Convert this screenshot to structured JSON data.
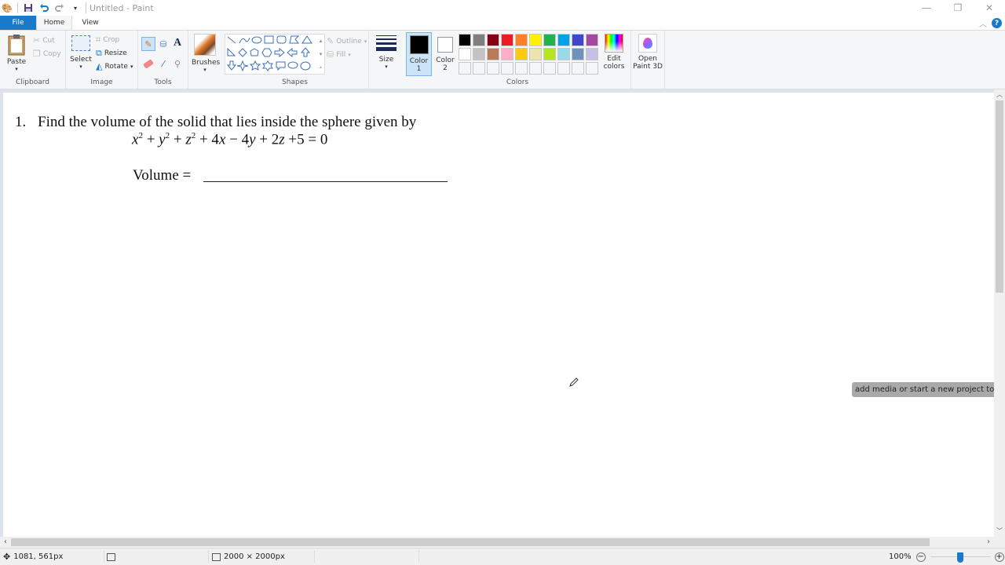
{
  "window": {
    "title": "Untitled - Paint",
    "controls": {
      "minimize": "—",
      "maximize": "❐",
      "close": "✕"
    }
  },
  "quick_access": {
    "icons": [
      "paint-app-icon",
      "save-icon",
      "undo-icon",
      "redo-icon",
      "customize-dropdown-icon"
    ]
  },
  "tabs": [
    {
      "label": "File",
      "active": false
    },
    {
      "label": "Home",
      "active": true
    },
    {
      "label": "View",
      "active": false
    }
  ],
  "ribbon": {
    "clipboard": {
      "label": "Clipboard",
      "paste": "Paste",
      "cut": "Cut",
      "copy": "Copy"
    },
    "image": {
      "label": "Image",
      "select": "Select",
      "crop": "Crop",
      "resize": "Resize",
      "rotate": "Rotate"
    },
    "tools": {
      "label": "Tools",
      "items": [
        "pencil",
        "fill",
        "text",
        "eraser",
        "color-picker",
        "magnifier"
      ]
    },
    "brushes": {
      "label": "Brushes"
    },
    "shapes": {
      "label": "Shapes",
      "outline": "Outline",
      "fill": "Fill"
    },
    "size": {
      "label": "Size"
    },
    "color1": {
      "label": "Color",
      "sub": "1",
      "value": "#000000"
    },
    "color2": {
      "label": "Color",
      "sub": "2",
      "value": "#ffffff"
    },
    "colors": {
      "label": "Colors",
      "row1": [
        "#000000",
        "#7f7f7f",
        "#880015",
        "#ed1c24",
        "#ff7f27",
        "#fff200",
        "#22b14c",
        "#00a2e8",
        "#3f48cc",
        "#a349a4"
      ],
      "row2": [
        "#ffffff",
        "#c3c3c3",
        "#b97a57",
        "#ffaec9",
        "#ffc90e",
        "#efe4b0",
        "#b5e61d",
        "#99d9ea",
        "#7092be",
        "#c8bfe7"
      ],
      "row3": [
        "#f5f6f7",
        "#f5f6f7",
        "#f5f6f7",
        "#f5f6f7",
        "#f5f6f7",
        "#f5f6f7",
        "#f5f6f7",
        "#f5f6f7",
        "#f5f6f7",
        "#f5f6f7"
      ]
    },
    "edit_colors": {
      "line1": "Edit",
      "line2": "colors"
    },
    "paint3d": {
      "line1": "Open",
      "line2": "Paint 3D"
    }
  },
  "document": {
    "number": "1.",
    "question": "Find the volume of the solid that lies inside the sphere given by",
    "equation": {
      "terms": [
        "x",
        "2",
        " + ",
        "y",
        "2",
        " + ",
        "z",
        "2",
        " + 4",
        "x",
        " − 4",
        "y",
        " + 2",
        "z",
        " +5 = 0"
      ]
    },
    "answer_label": "Volume ="
  },
  "tooltip": "add media or start a new project to enable",
  "status": {
    "cursor_position": "1081, 561px",
    "selection_size": "",
    "canvas_size": "2000 × 2000px",
    "zoom": "100%",
    "zoom_level_percent": 100
  }
}
